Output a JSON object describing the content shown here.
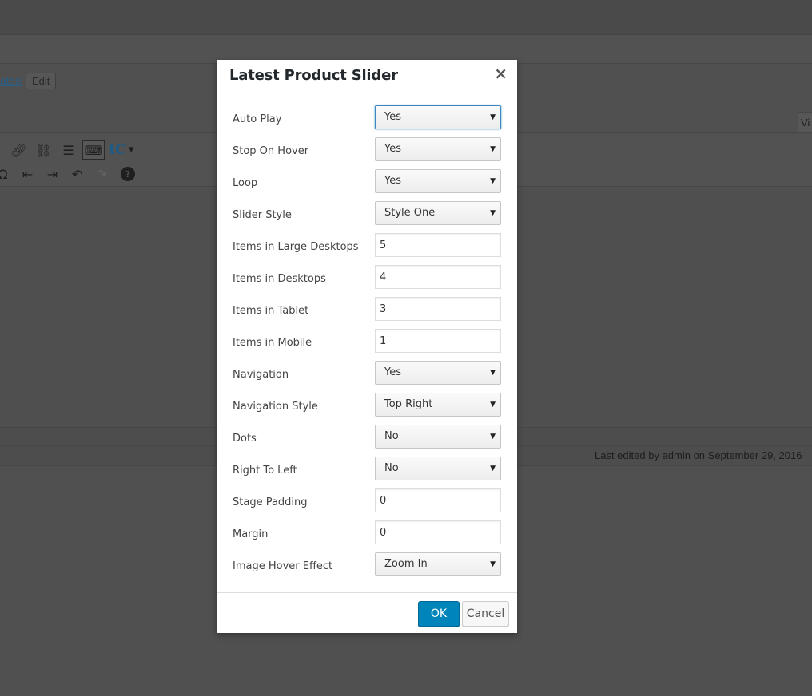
{
  "background": {
    "permalink_text": "ator/",
    "edit_button": "Edit",
    "visual_tab": "Vi",
    "toolbar_row1": [
      {
        "name": "link-icon",
        "glyph": "🔗︎"
      },
      {
        "name": "unlink-icon",
        "glyph": "⛓"
      },
      {
        "name": "read-more-icon",
        "glyph": "☰"
      },
      {
        "name": "toolbar-toggle-icon",
        "glyph": "⌨"
      },
      {
        "name": "tc-plugin-icon",
        "glyph": "tC▾"
      }
    ],
    "toolbar_row2": [
      {
        "name": "special-char-icon",
        "glyph": "Ω"
      },
      {
        "name": "outdent-icon",
        "glyph": "⇤"
      },
      {
        "name": "indent-icon",
        "glyph": "⇥"
      },
      {
        "name": "undo-icon",
        "glyph": "↶"
      },
      {
        "name": "redo-icon",
        "glyph": "↷"
      },
      {
        "name": "help-icon",
        "glyph": "?"
      }
    ],
    "last_edited": "Last edited by admin on September 29, 2016"
  },
  "modal": {
    "title": "Latest Product Slider",
    "close_glyph": "×",
    "fields": {
      "auto_play": {
        "label": "Auto Play",
        "value": "Yes"
      },
      "stop_on_hover": {
        "label": "Stop On Hover",
        "value": "Yes"
      },
      "loop": {
        "label": "Loop",
        "value": "Yes"
      },
      "slider_style": {
        "label": "Slider Style",
        "value": "Style One"
      },
      "items_large_desktops": {
        "label": "Items in Large Desktops",
        "value": "5"
      },
      "items_desktops": {
        "label": "Items in Desktops",
        "value": "4"
      },
      "items_tablet": {
        "label": "Items in Tablet",
        "value": "3"
      },
      "items_mobile": {
        "label": "Items in Mobile",
        "value": "1"
      },
      "navigation": {
        "label": "Navigation",
        "value": "Yes"
      },
      "navigation_style": {
        "label": "Navigation Style",
        "value": "Top Right"
      },
      "dots": {
        "label": "Dots",
        "value": "No"
      },
      "right_to_left": {
        "label": "Right To Left",
        "value": "No"
      },
      "stage_padding": {
        "label": "Stage Padding",
        "value": "0"
      },
      "margin": {
        "label": "Margin",
        "value": "0"
      },
      "image_hover_effect": {
        "label": "Image Hover Effect",
        "value": "Zoom In"
      }
    },
    "dropdown_arrow": "▼",
    "ok_label": "OK",
    "cancel_label": "Cancel"
  },
  "colors": {
    "overlay": "#505050",
    "primary_button": "#0085ba",
    "focus_border": "#3a86c2"
  }
}
